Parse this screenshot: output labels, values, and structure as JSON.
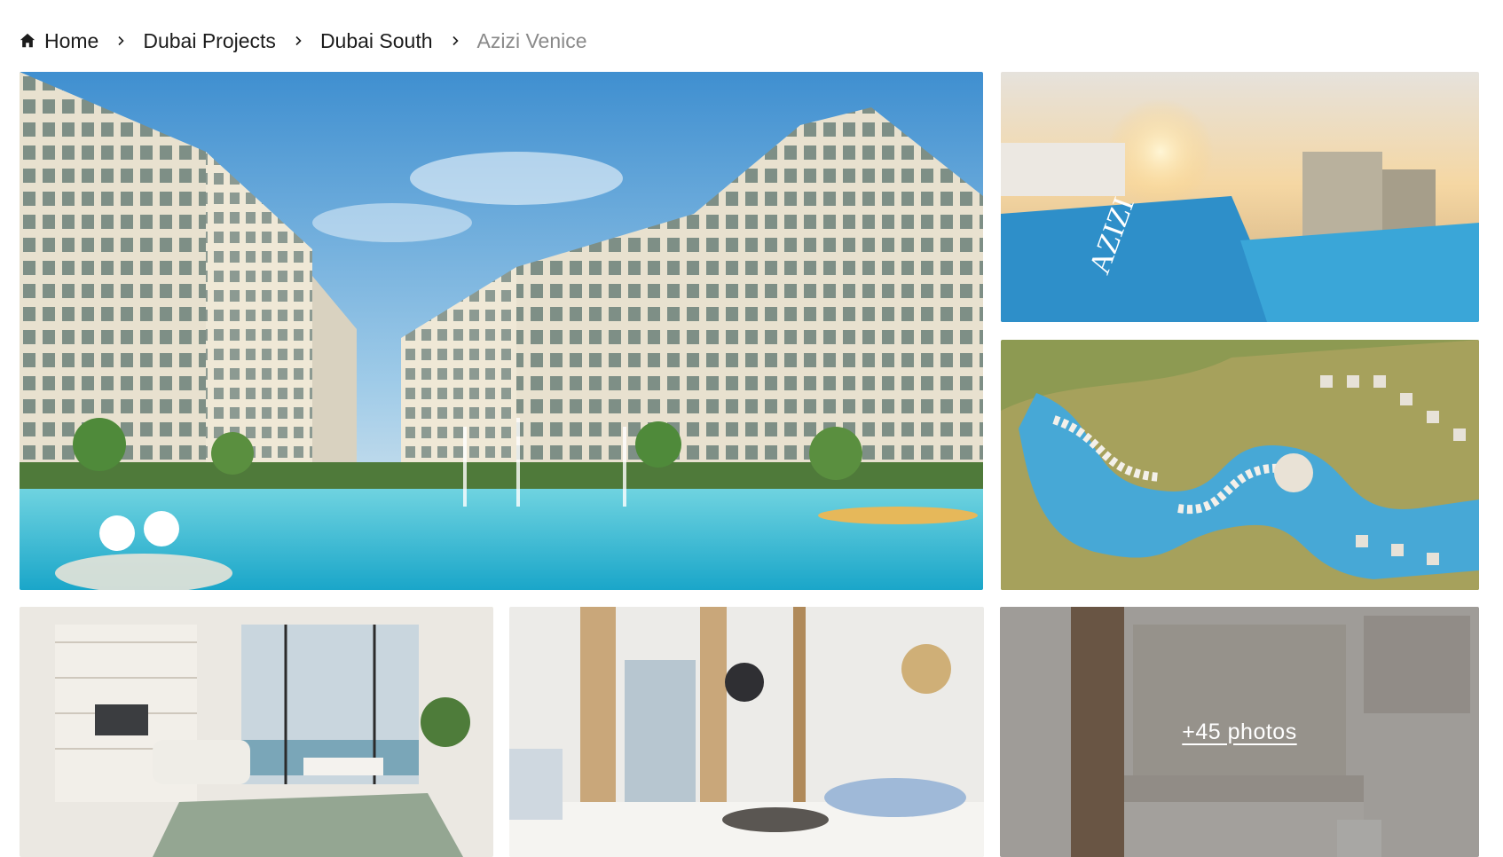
{
  "breadcrumb": {
    "items": [
      {
        "label": "Home",
        "icon": "home-icon"
      },
      {
        "label": "Dubai Projects"
      },
      {
        "label": "Dubai South"
      },
      {
        "label": "Azizi Venice",
        "current": true
      }
    ],
    "separator_icon": "chevron-right-icon"
  },
  "gallery": {
    "photos": [
      {
        "name": "canal-kayak-render"
      },
      {
        "name": "rooftop-pool-sunset-render"
      },
      {
        "name": "aerial-masterplan-render"
      },
      {
        "name": "living-dining-room-render"
      },
      {
        "name": "lobby-lounge-render"
      },
      {
        "name": "bathroom-render"
      }
    ],
    "more_photos_label": "+45 photos"
  },
  "colors": {
    "text": "#1c1c1c",
    "current_crumb": "#8a8a8a",
    "overlay": "rgba(60,58,56,0.42)"
  }
}
